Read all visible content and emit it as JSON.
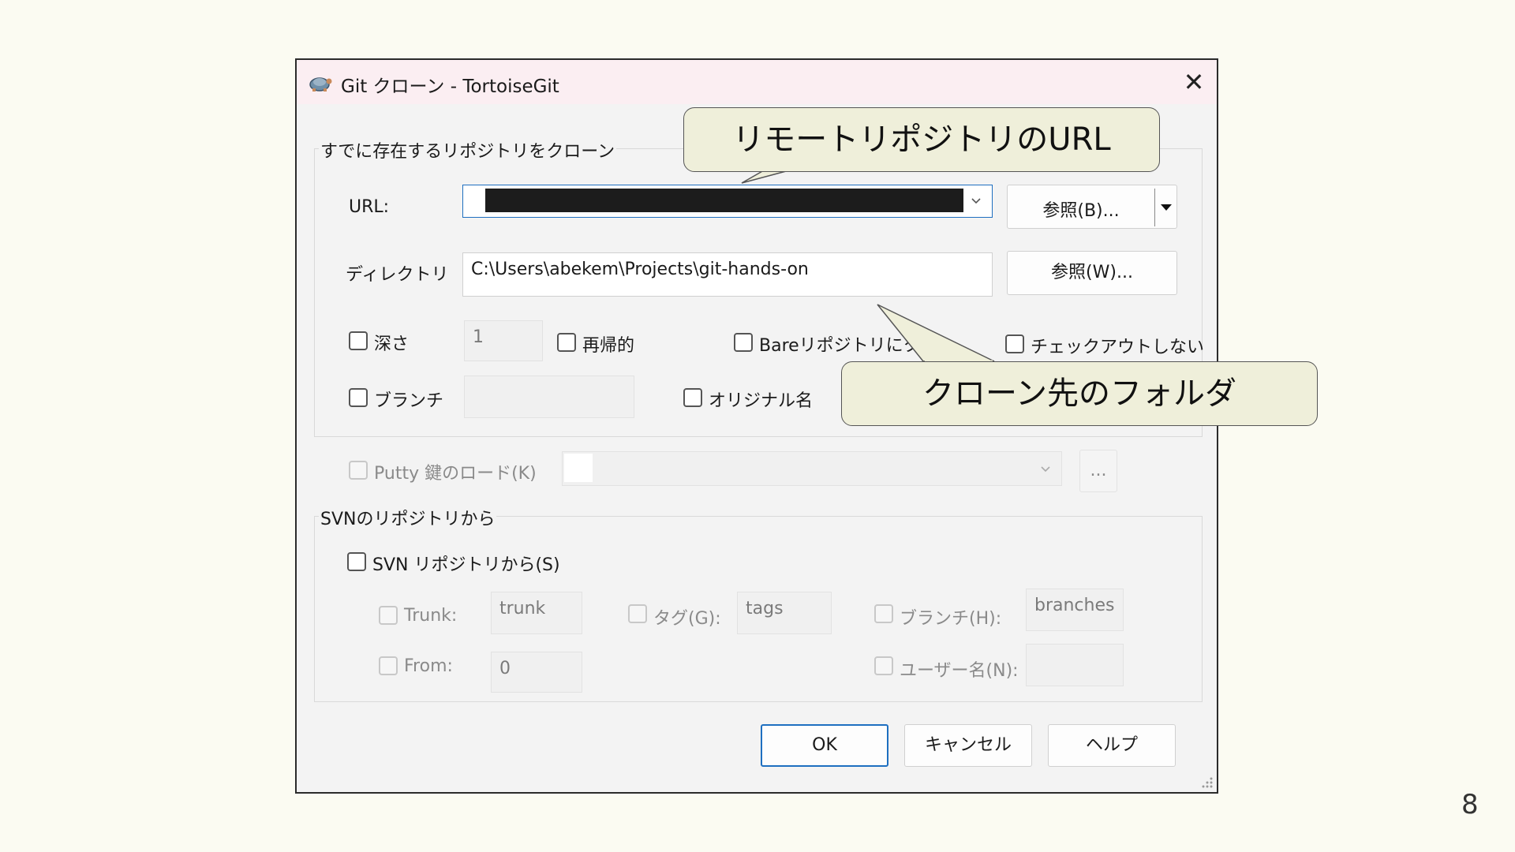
{
  "window": {
    "title": "Git クローン - TortoiseGit",
    "close_symbol": "✕"
  },
  "clone_group": {
    "title": "すでに存在するリポジトリをクローン",
    "url_label": "URL:",
    "url_value": "",
    "browse_url_label": "参照(B)...",
    "directory_label": "ディレクトリ",
    "directory_value": "C:\\Users\\abekem\\Projects\\git-hands-on",
    "browse_dir_label": "参照(W)...",
    "depth_label": "深さ",
    "depth_value": "1",
    "recursive_label": "再帰的",
    "bare_label": "Bareリポジトリにクロ",
    "no_checkout_label": "チェックアウトしない",
    "branch_label": "ブランチ",
    "branch_value": "",
    "origin_name_label": "オリジナル名"
  },
  "putty": {
    "label": "Putty 鍵のロード(K)",
    "browse_label": "..."
  },
  "svn_group": {
    "title": "SVNのリポジトリから",
    "from_svn_label": "SVN リポジトリから(S)",
    "trunk_label": "Trunk:",
    "trunk_value": "trunk",
    "tags_label": "タグ(G):",
    "tags_value": "tags",
    "branches_label": "ブランチ(H):",
    "branches_value": "branches",
    "from_label": "From:",
    "from_value": "0",
    "username_label": "ユーザー名(N):",
    "username_value": ""
  },
  "buttons": {
    "ok": "OK",
    "cancel": "キャンセル",
    "help": "ヘルプ"
  },
  "callouts": {
    "remote_url": "リモートリポジトリのURL",
    "clone_dest": "クローン先のフォルダ"
  },
  "slide": {
    "page_number": "8"
  },
  "colors": {
    "redaction": "#1c1c1c",
    "callout_fill": "#efefda",
    "primary_border": "#1e6fc0"
  }
}
